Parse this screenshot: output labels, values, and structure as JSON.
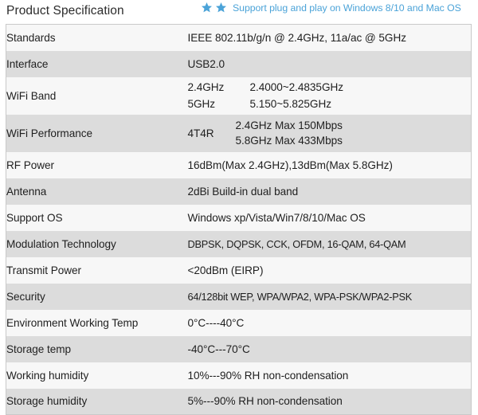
{
  "header": {
    "title": "Product Specification",
    "star_icon_left": "star-icon",
    "star_icon_right": "star-icon",
    "note": "Support plug and play on Windows 8/10 and Mac OS",
    "star_color": "#4ba3d8",
    "note_color": "#4ba3d8"
  },
  "table": {
    "row_light_color": "#f7f7f7",
    "row_dark_color": "#dcdcdc",
    "border_color": "#c9c9c9",
    "rows": [
      {
        "label": "Standards",
        "value": "IEEE 802.11b/g/n @ 2.4GHz, 11a/ac @ 5GHz"
      },
      {
        "label": "Interface",
        "value": "USB2.0"
      },
      {
        "label": "WiFi Band",
        "band": [
          {
            "key": "2.4GHz",
            "range": "2.4000~2.4835GHz"
          },
          {
            "key": "5GHz",
            "range": "5.150~5.825GHz"
          }
        ]
      },
      {
        "label": "WiFi Performance",
        "perf_key": "4T4R",
        "perf_lines": [
          "2.4GHz Max 150Mbps",
          "5.8GHz Max 433Mbps"
        ]
      },
      {
        "label": "RF Power",
        "value": "16dBm(Max 2.4GHz),13dBm(Max 5.8GHz)"
      },
      {
        "label": "Antenna",
        "value": "2dBi Build-in dual band"
      },
      {
        "label": "Support OS",
        "value": "Windows xp/Vista/Win7/8/10/Mac OS"
      },
      {
        "label": "Modulation Technology",
        "value": "DBPSK, DQPSK, CCK, OFDM, 16-QAM, 64-QAM"
      },
      {
        "label": "Transmit Power",
        "value": "<20dBm (EIRP)"
      },
      {
        "label": "Security",
        "value": "64/128bit WEP, WPA/WPA2, WPA-PSK/WPA2-PSK"
      },
      {
        "label": "Environment Working Temp",
        "value": "0°C----40°C"
      },
      {
        "label": "Storage temp",
        "value": "-40°C---70°C"
      },
      {
        "label": "Working humidity",
        "value": "10%---90% RH non-condensation"
      },
      {
        "label": "Storage humidity",
        "value": "5%---90% RH non-condensation"
      }
    ]
  }
}
